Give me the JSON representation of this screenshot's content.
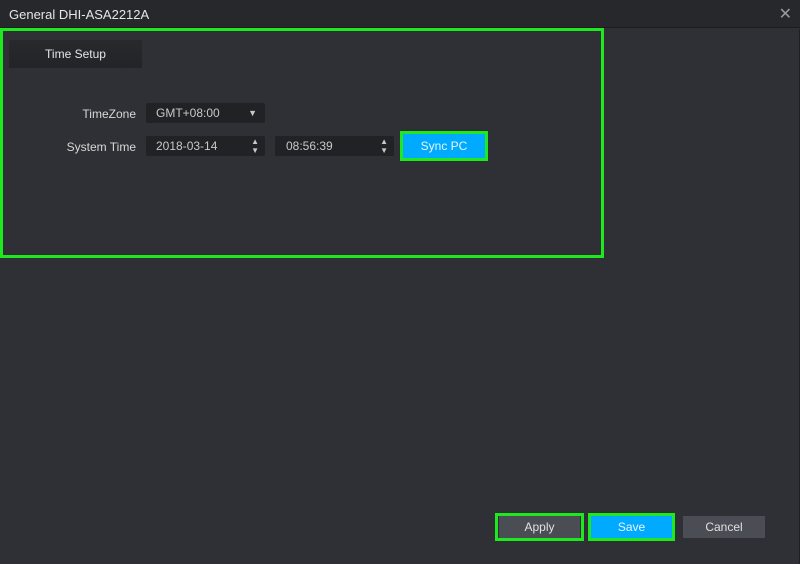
{
  "window": {
    "title": "General DHI-ASA2212A",
    "close_icon": "close-icon"
  },
  "tabs": [
    {
      "label": "Time Setup",
      "active": true
    }
  ],
  "form": {
    "timezone_label": "TimeZone",
    "timezone_value": "GMT+08:00",
    "system_time_label": "System Time",
    "date_value": "2018-03-14",
    "time_value": "08:56:39",
    "sync_pc_label": "Sync PC"
  },
  "footer": {
    "apply_label": "Apply",
    "save_label": "Save",
    "cancel_label": "Cancel"
  },
  "colors": {
    "accent": "#00aaff",
    "highlight": "#1ee81e",
    "background": "#2e3035"
  }
}
